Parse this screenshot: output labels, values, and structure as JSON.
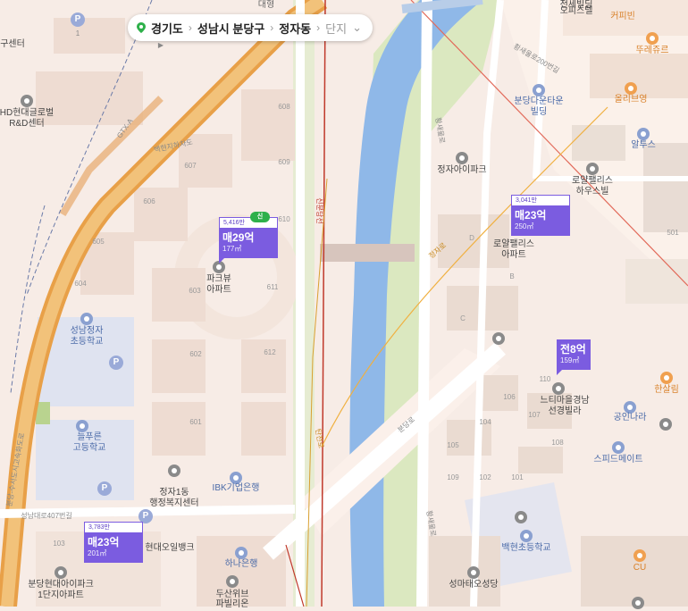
{
  "breadcrumb": {
    "items": [
      "경기도",
      "성남시 분당구",
      "정자동"
    ],
    "last_muted": "단지"
  },
  "map_labels": {
    "daehyeon": "대형",
    "gugu_center": "구센터",
    "hd_center_1": "HD현대글로벌",
    "hd_center_2": "R&D센터",
    "gyeongbu": "GTX-A",
    "backhyun_road": "백현지하차도",
    "apt_blocks": [
      "608",
      "607",
      "609",
      "606",
      "610",
      "605",
      "611",
      "604",
      "603",
      "612",
      "602",
      "601"
    ],
    "parkview_1": "파크뷰",
    "parkview_2": "아파트",
    "sinbundang_line": "신분당선",
    "seongnam_jeongja_1": "성남정자",
    "seongnam_jeongja_2": "초등학교",
    "neulpureun_1": "늘푸른",
    "neulpureun_2": "고등학교",
    "jeongja1_1": "정자1동",
    "jeongja1_2": "행정복지센터",
    "ibk": "IBK기업은행",
    "hyundai_oil": "현대오일뱅크",
    "hana": "하나은행",
    "doosan_1": "두산위브",
    "doosan_2": "파빌리온",
    "seongnam_road": "성남대로407번길",
    "bundang_hd_1": "분당현대아이파크",
    "bundang_hd_2": "1단지아파트",
    "block_103": "103",
    "highway_text": "분당-수서도시고속화도로",
    "jeongja_ipark": "정자아이파크",
    "bundang_downtown_1": "분당다운타운",
    "bundang_downtown_2": "빌딩",
    "hwangsaeul_200": "황새울로200번길",
    "hwangsaeul": "황새울로",
    "office_1": "전세빌딩",
    "office_2": "오피스텔",
    "coffee_bean": "커피빈",
    "tous": "뚜레쥬르",
    "oliveyoung": "올리브영",
    "altos": "알투스",
    "royal_1": "로얄팰리스",
    "royal_2": "하우스빌",
    "royal_apt_1": "로얄팰리스",
    "royal_apt_2": "아파트",
    "block_501": "501",
    "neuti_1": "느티마을경남",
    "neuti_2": "선경빌라",
    "hansalim": "한살림",
    "gongin": "공인나라",
    "speed": "스피드메이트",
    "baekhyeon_school": "백현초등학교",
    "cu": "CU",
    "seongma": "성마태오성당",
    "bundang_road": "분당로",
    "tancheon_road": "탄천로",
    "block_letters": [
      "D",
      "B",
      "C"
    ],
    "blocks_right": [
      "110",
      "106",
      "107",
      "104",
      "108",
      "105",
      "102",
      "101",
      "109"
    ],
    "jeonja_road": "정자로"
  },
  "markers": [
    {
      "households": "5,416만",
      "price": "매29억",
      "area": "177㎡"
    },
    {
      "households": "3,041만",
      "price": "매23억",
      "area": "250㎡"
    },
    {
      "households": "",
      "price": "전8억",
      "area": "159㎡"
    },
    {
      "households": "3,783만",
      "price": "매23억",
      "area": "201㎡"
    }
  ],
  "green_badge": "신",
  "colors": {
    "river": "#8fb8e8",
    "green_belt": "#dbe8c0",
    "highway": "#e8a048",
    "road": "#ffffff",
    "marker": "#7b5ce0",
    "background": "#f7ece6"
  }
}
